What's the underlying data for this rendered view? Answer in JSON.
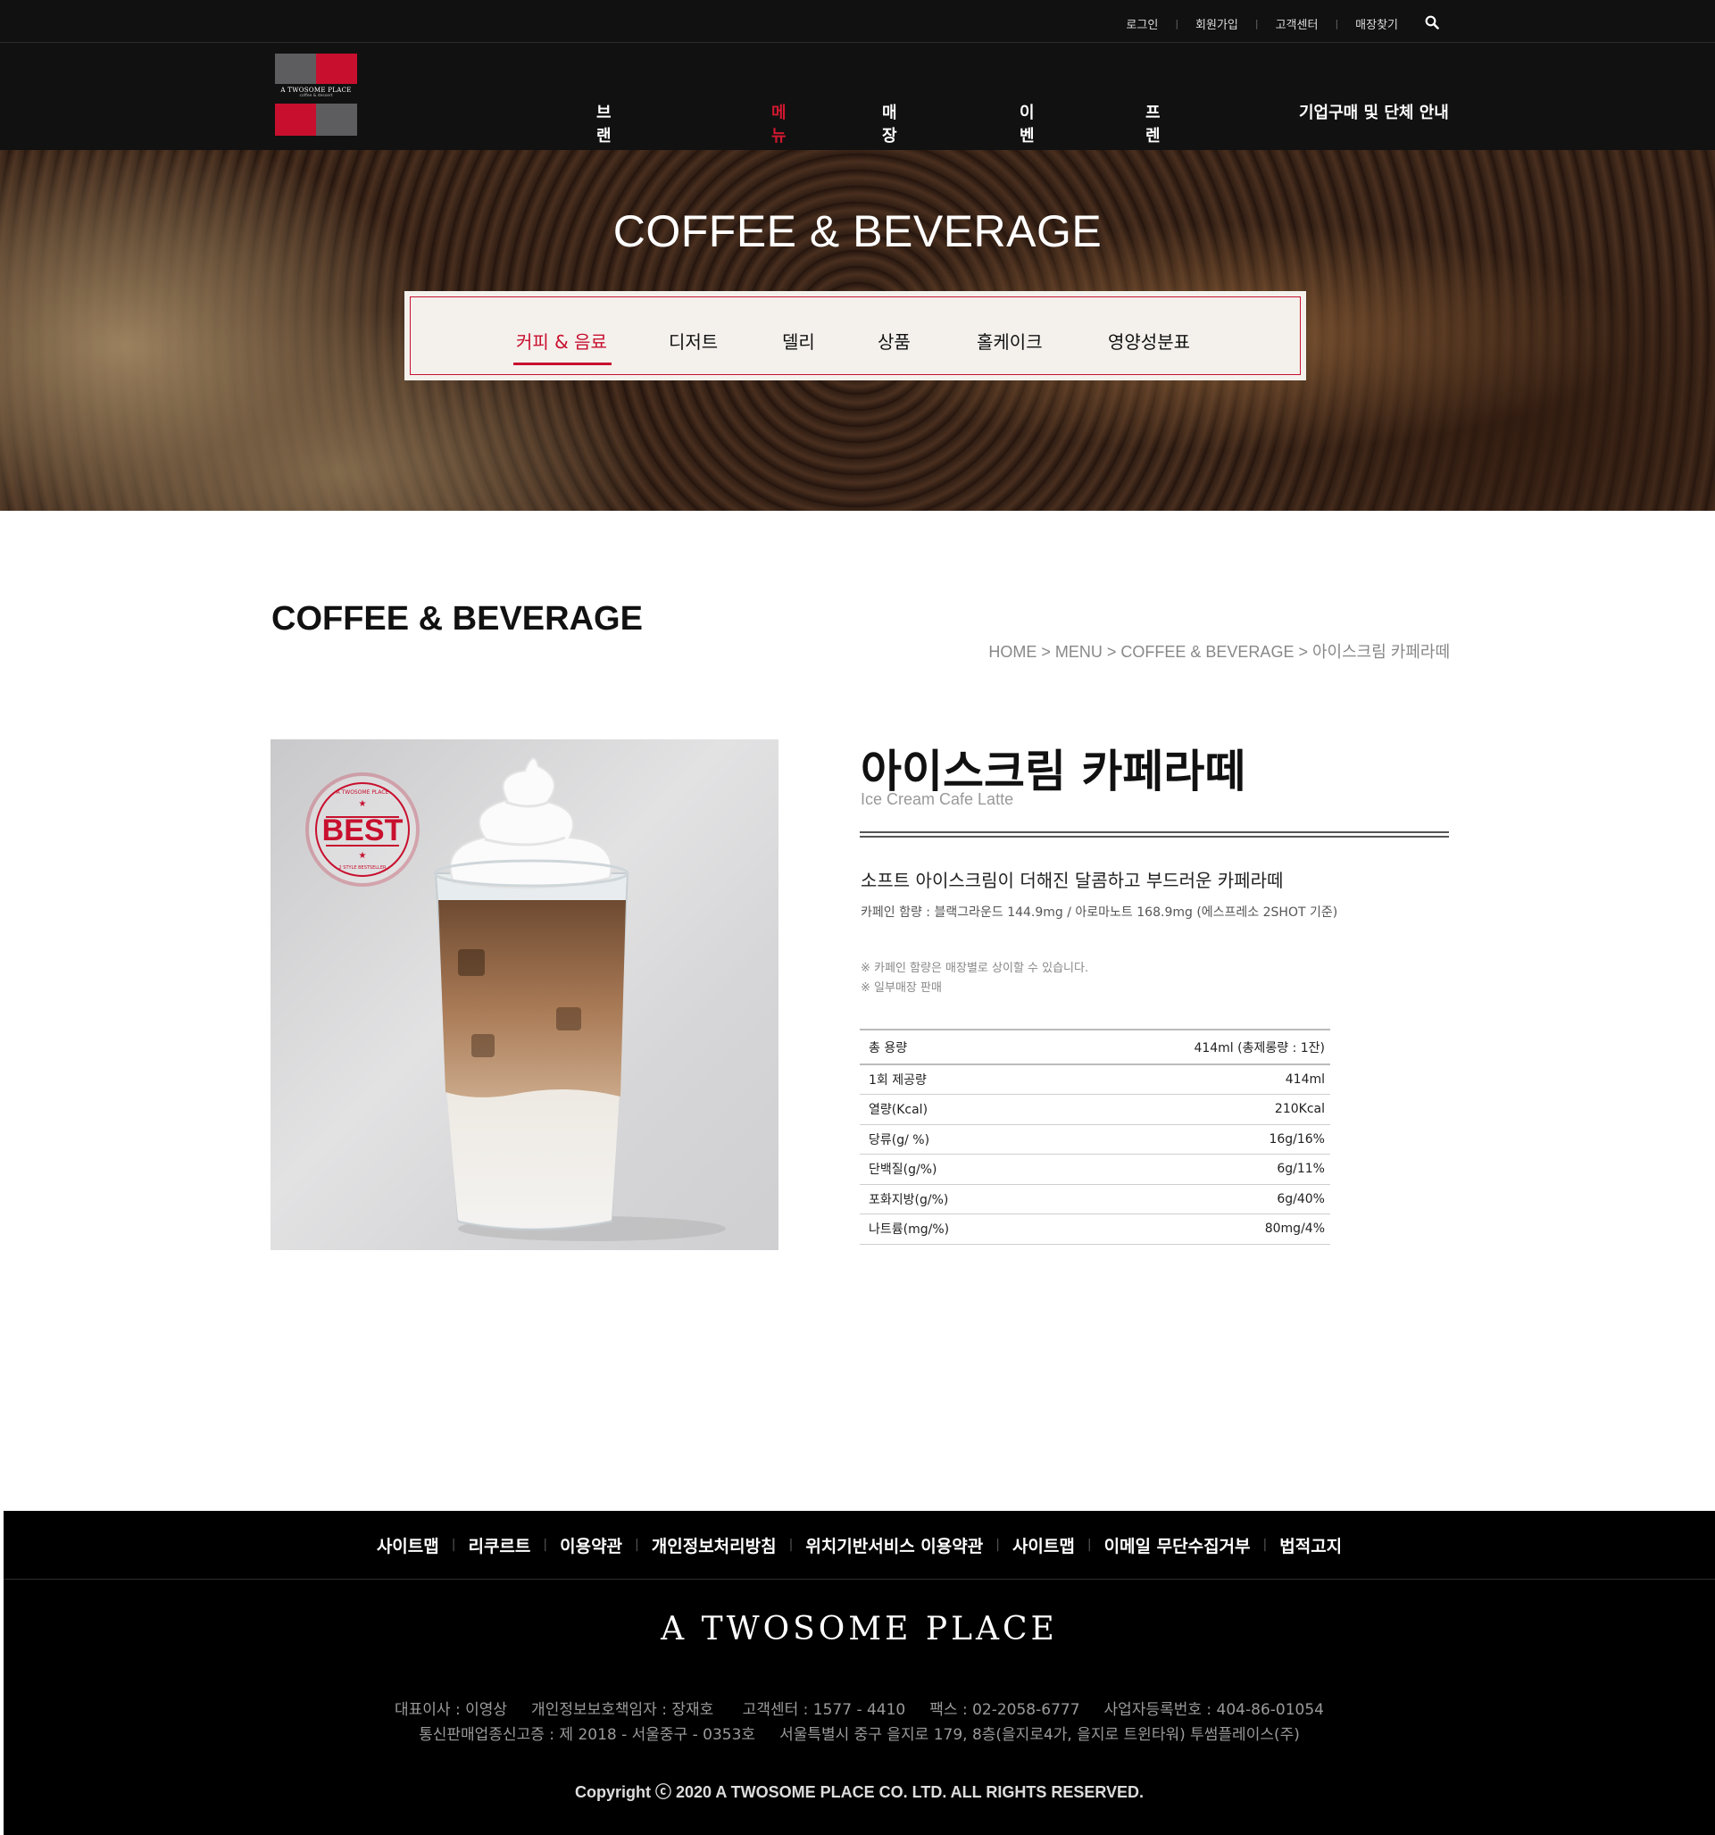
{
  "util_nav": {
    "items": [
      "로그인",
      "회원가입",
      "고객센터",
      "매장찾기"
    ],
    "separator": "|"
  },
  "logo": {
    "line1": "A TWOSOME PLACE",
    "line2": "coffee & dessert"
  },
  "gnb": {
    "items": [
      "브랜드 스토리",
      "메뉴",
      "매장정보",
      "이벤트",
      "프렌차이즈",
      "기업구매 및 단체 안내"
    ],
    "active_index": 1
  },
  "hero": {
    "title": "COFFEE & BEVERAGE"
  },
  "subnav": {
    "items": [
      "커피 & 음료",
      "디저트",
      "델리",
      "상품",
      "홀케이크",
      "영양성분표"
    ],
    "active_index": 0
  },
  "page": {
    "title": "COFFEE & BEVERAGE",
    "breadcrumb": "HOME > MENU > COFFEE & BEVERAGE > 아이스크림 카페라떼"
  },
  "product": {
    "badge": "BEST",
    "badge_ring_top": "A TWOSOME PLACE",
    "badge_ring_bottom": "2 STYLE BESTSELLER",
    "name": "아이스크림 카페라떼",
    "name_en": "Ice Cream Cafe Latte",
    "description": "소프트 아이스크림이 더해진 달콤하고 부드러운 카페라떼",
    "caffeine": "카페인 함량 : 블랙그라운드 144.9mg / 아로마노트 168.9mg (에스프레소 2SHOT 기준)",
    "notes": [
      "※ 카페인 함량은 매장별로 상이할 수 있습니다.",
      "※ 일부매장 판매"
    ]
  },
  "nutrition": [
    {
      "label": "총 용량",
      "value": "414ml (총제롱량 : 1잔)"
    },
    {
      "label": "1회 제공량",
      "value": "414ml"
    },
    {
      "label": "열량(Kcal)",
      "value": "210Kcal"
    },
    {
      "label": "당류(g/ %)",
      "value": "16g/16%"
    },
    {
      "label": "단백질(g/%)",
      "value": "6g/11%"
    },
    {
      "label": "포화지방(g/%)",
      "value": "6g/40%"
    },
    {
      "label": "나트륨(mg/%)",
      "value": "80mg/4%"
    }
  ],
  "footer": {
    "links": [
      "사이트맵",
      "리쿠르트",
      "이용약관",
      "개인정보처리방침",
      "위치기반서비스 이용약관",
      "사이트맵",
      "이메일 무단수집거부",
      "법적고지"
    ],
    "brand": "A TWOSOME PLACE",
    "info_line1": "대표이사 : 이영상     개인정보보호책임자 : 장재호      고객센터 : 1577 - 4410     팩스 : 02-2058-6777     사업자등록번호 : 404-86-01054",
    "info_line2": "통신판매업종신고증 : 제 2018 - 서울중구 - 0353호     서울특별시 중구 을지로 179, 8층(을지로4가, 을지로 트윈타워) 투썸플레이스(주)",
    "copyright": "Copyright ⓒ 2020 A TWOSOME PLACE CO. LTD. ALL RIGHTS RESERVED."
  },
  "colors": {
    "accent": "#c8102e",
    "header_bg": "#111111",
    "footer_bg": "#000000"
  }
}
